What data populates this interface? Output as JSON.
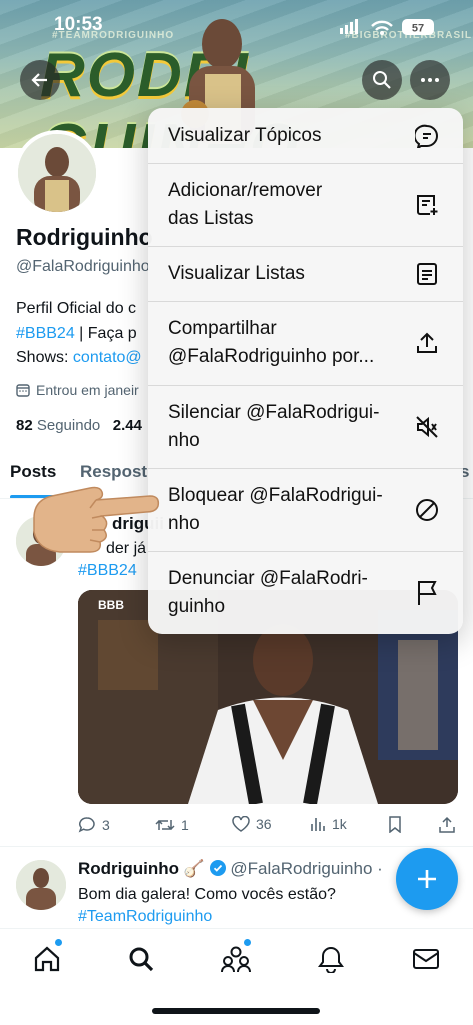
{
  "status_bar": {
    "time": "10:53",
    "battery": "57"
  },
  "banner": {
    "word": "RODRI  GUINHO",
    "tag_left": "#TEAMRODRIGUINHO",
    "tag_right": "#BIGBROTHERBRASIL"
  },
  "profile": {
    "name": "Rodriguinho",
    "handle": "@FalaRodriguinho",
    "bio_line1": "Perfil Oficial do c",
    "bio_line2_hashtag": "#BBB24",
    "bio_line2_rest": " | Faça p",
    "bio_line3_prefix": "Shows: ",
    "bio_line3_link": "contato@",
    "joined": "Entrou em janeir",
    "following_count": "82",
    "following_label": "Seguindo",
    "followers_count": "2.44"
  },
  "tabs": [
    {
      "label": "Posts"
    },
    {
      "label": "Respost"
    },
    {
      "label": "s"
    }
  ],
  "post1": {
    "name_fragment": "driguii",
    "text_fragment": "der já",
    "hashtag": "#BBB24",
    "image_logo": "BBB",
    "stats": {
      "replies": "3",
      "reposts": "1",
      "likes": "36",
      "views": "1k"
    }
  },
  "post2": {
    "name": "Rodriguinho",
    "handle": "@FalaRodriguinho",
    "dot": "·",
    "body": "Bom dia galera! Como vocês estão?",
    "hashtag": "#TeamRodriguinho"
  },
  "menu": {
    "items": [
      {
        "label": "Visualizar Tópicos",
        "icon": "topics-icon"
      },
      {
        "label": "Adicionar/remover\ndas Listas",
        "icon": "list-add-icon"
      },
      {
        "label": "Visualizar Listas",
        "icon": "lists-icon"
      },
      {
        "label": "Compartilhar\n@FalaRodriguinho por...",
        "icon": "share-icon"
      },
      {
        "label": "Silenciar @FalaRodrigui-\nnho",
        "icon": "mute-icon"
      },
      {
        "label": "Bloquear @FalaRodrigui-\nnho",
        "icon": "block-icon"
      },
      {
        "label": "Denunciar @FalaRodri-\nguinho",
        "icon": "flag-icon"
      }
    ]
  },
  "colors": {
    "accent": "#1d9bf0",
    "text": "#0f1419",
    "muted": "#536471",
    "menu_bg": "#f6f6f6"
  }
}
